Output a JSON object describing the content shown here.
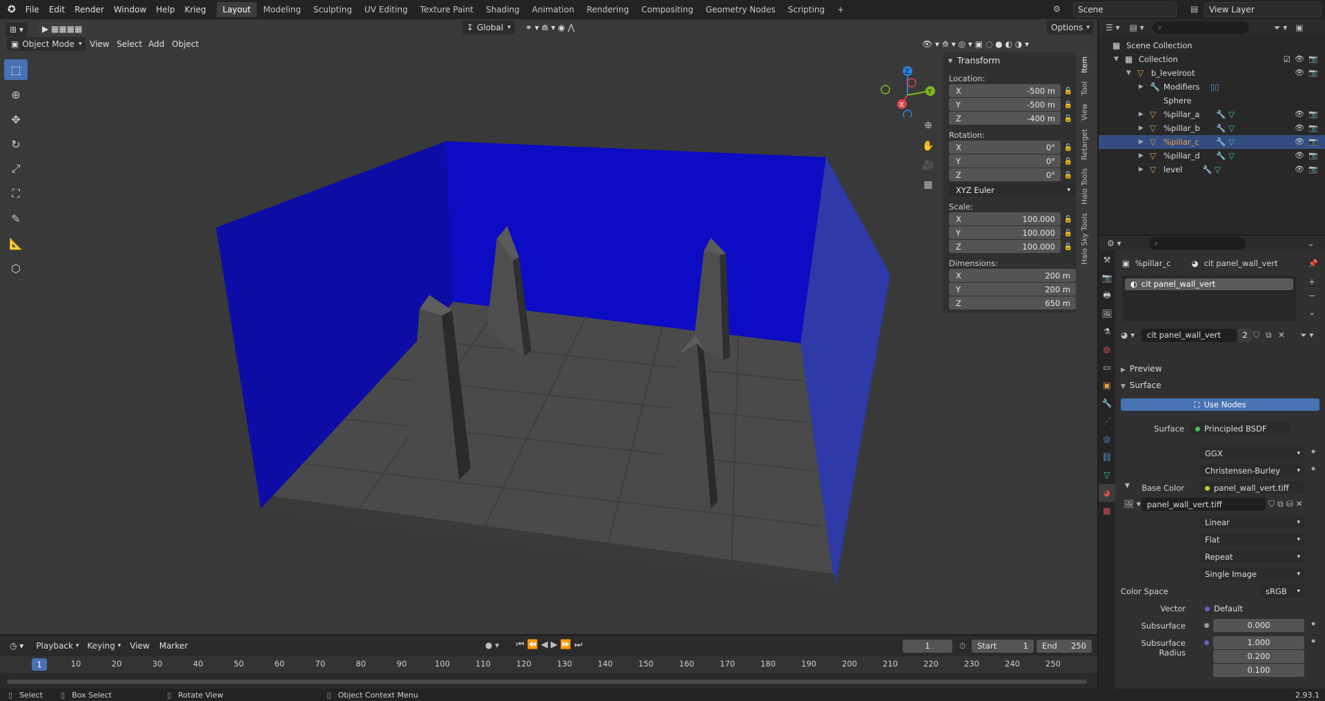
{
  "topbar": {
    "menus": [
      "File",
      "Edit",
      "Render",
      "Window",
      "Help",
      "Krieg"
    ],
    "workspaces": [
      "Layout",
      "Modeling",
      "Sculpting",
      "UV Editing",
      "Texture Paint",
      "Shading",
      "Animation",
      "Rendering",
      "Compositing",
      "Geometry Nodes",
      "Scripting"
    ],
    "active_workspace": "Layout",
    "scene": "Scene",
    "view_layer": "View Layer"
  },
  "viewport": {
    "mode": "Object Mode",
    "menus": [
      "View",
      "Select",
      "Add",
      "Object"
    ],
    "orientation": "Global",
    "options": "Options",
    "gizmo": {
      "x": "X",
      "y": "Y",
      "z": "Z"
    },
    "wall_color": "#0b0bb8",
    "side_wall_color": "#2c38a8"
  },
  "npanel": {
    "title": "Transform",
    "location_label": "Location:",
    "location": [
      {
        "axis": "X",
        "value": "-500 m"
      },
      {
        "axis": "Y",
        "value": "-500 m"
      },
      {
        "axis": "Z",
        "value": "-400 m"
      }
    ],
    "rotation_label": "Rotation:",
    "rotation": [
      {
        "axis": "X",
        "value": "0°"
      },
      {
        "axis": "Y",
        "value": "0°"
      },
      {
        "axis": "Z",
        "value": "0°"
      }
    ],
    "rotation_mode": "XYZ Euler",
    "scale_label": "Scale:",
    "scale": [
      {
        "axis": "X",
        "value": "100.000"
      },
      {
        "axis": "Y",
        "value": "100.000"
      },
      {
        "axis": "Z",
        "value": "100.000"
      }
    ],
    "dimensions_label": "Dimensions:",
    "dimensions": [
      {
        "axis": "X",
        "value": "200 m"
      },
      {
        "axis": "Y",
        "value": "200 m"
      },
      {
        "axis": "Z",
        "value": "650 m"
      }
    ],
    "tabs": [
      "Item",
      "Tool",
      "View",
      "Retarget",
      "Halo Tools",
      "Halo Sky Tools"
    ]
  },
  "outliner": {
    "items": [
      {
        "label": "Scene Collection",
        "indent": 0
      },
      {
        "label": "Collection",
        "indent": 1
      },
      {
        "label": "b_levelroot",
        "indent": 2
      },
      {
        "label": "Modifiers",
        "indent": 3
      },
      {
        "label": "Sphere",
        "indent": 3
      },
      {
        "label": "%pillar_a",
        "indent": 3
      },
      {
        "label": "%pillar_b",
        "indent": 3
      },
      {
        "label": "%pillar_c",
        "indent": 3,
        "selected": true
      },
      {
        "label": "%pillar_d",
        "indent": 3
      },
      {
        "label": "level",
        "indent": 3
      }
    ]
  },
  "properties": {
    "object": "%pillar_c",
    "material": "cit panel_wall_vert",
    "slot": "cit panel_wall_vert",
    "material_field": "cit panel_wall_vert",
    "users": "2",
    "preview": "Preview",
    "surface_section": "Surface",
    "use_nodes": "Use Nodes",
    "surface_label": "Surface",
    "surface_value": "Principled BSDF",
    "distribution": "GGX",
    "subsurface_method": "Christensen-Burley",
    "base_color_label": "Base Color",
    "base_color_value": "panel_wall_vert.tiff",
    "image_name": "panel_wall_vert.tiff",
    "interpolation": "Linear",
    "projection": "Flat",
    "extension": "Repeat",
    "source": "Single Image",
    "color_space_label": "Color Space",
    "color_space": "sRGB",
    "vector_label": "Vector",
    "vector_value": "Default",
    "subsurface_label": "Subsurface",
    "subsurface_value": "0.000",
    "subsurface_radius_label": "Subsurface Radius",
    "subsurface_radius": [
      "1.000",
      "0.200",
      "0.100"
    ]
  },
  "timeline": {
    "menus": [
      "Playback",
      "Keying",
      "View",
      "Marker"
    ],
    "current_frame": "1",
    "start_label": "Start",
    "start": "1",
    "end_label": "End",
    "end": "250",
    "ticks": [
      "10",
      "20",
      "30",
      "40",
      "50",
      "60",
      "70",
      "80",
      "90",
      "100",
      "110",
      "120",
      "130",
      "140",
      "150",
      "160",
      "170",
      "180",
      "190",
      "200",
      "210",
      "220",
      "230",
      "240",
      "250"
    ]
  },
  "status": {
    "select": "Select",
    "box_select": "Box Select",
    "rotate_view": "Rotate View",
    "context_menu": "Object Context Menu",
    "version": "2.93.1"
  }
}
